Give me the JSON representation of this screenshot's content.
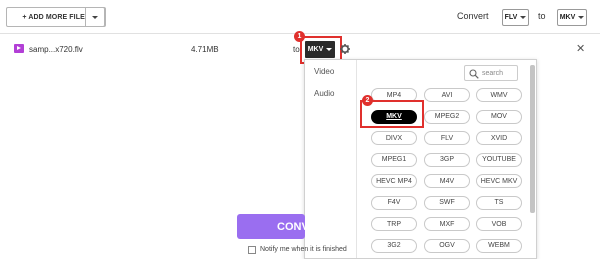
{
  "toolbar": {
    "add_files_label": "+ ADD MORE FILES",
    "convert_label": "Convert",
    "from_format": "FLV",
    "to_label": "to",
    "to_format": "MKV"
  },
  "file": {
    "name": "samp...x720.flv",
    "size": "4.71MB",
    "to_label": "to",
    "target_format": "MKV"
  },
  "annotations": {
    "step1": "1",
    "step2": "2",
    "highlight_color": "#e0302d"
  },
  "dropdown": {
    "tabs": [
      "Video",
      "Audio"
    ],
    "search_placeholder": "search",
    "selected": "MKV",
    "formats": [
      [
        "MP4",
        "AVI",
        "WMV"
      ],
      [
        "MKV",
        "MPEG2",
        "MOV"
      ],
      [
        "DIVX",
        "FLV",
        "XVID"
      ],
      [
        "MPEG1",
        "3GP",
        "YOUTUBE"
      ],
      [
        "HEVC MP4",
        "M4V",
        "HEVC MKV"
      ],
      [
        "F4V",
        "SWF",
        "TS"
      ],
      [
        "TRP",
        "MXF",
        "VOB"
      ],
      [
        "3G2",
        "OGV",
        "WEBM"
      ]
    ]
  },
  "bottom": {
    "convert_button": "CONV",
    "notify_label": "Notify me when it is finished"
  },
  "colors": {
    "accent": "#9a6ef0",
    "file_icon": "#b23fd6"
  }
}
